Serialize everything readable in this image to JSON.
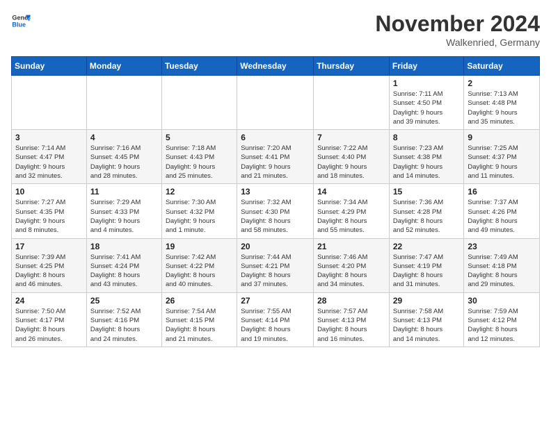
{
  "header": {
    "logo_general": "General",
    "logo_blue": "Blue",
    "month_title": "November 2024",
    "location": "Walkenried, Germany"
  },
  "calendar": {
    "days_of_week": [
      "Sunday",
      "Monday",
      "Tuesday",
      "Wednesday",
      "Thursday",
      "Friday",
      "Saturday"
    ],
    "weeks": [
      [
        {
          "day": "",
          "info": ""
        },
        {
          "day": "",
          "info": ""
        },
        {
          "day": "",
          "info": ""
        },
        {
          "day": "",
          "info": ""
        },
        {
          "day": "",
          "info": ""
        },
        {
          "day": "1",
          "info": "Sunrise: 7:11 AM\nSunset: 4:50 PM\nDaylight: 9 hours\nand 39 minutes."
        },
        {
          "day": "2",
          "info": "Sunrise: 7:13 AM\nSunset: 4:48 PM\nDaylight: 9 hours\nand 35 minutes."
        }
      ],
      [
        {
          "day": "3",
          "info": "Sunrise: 7:14 AM\nSunset: 4:47 PM\nDaylight: 9 hours\nand 32 minutes."
        },
        {
          "day": "4",
          "info": "Sunrise: 7:16 AM\nSunset: 4:45 PM\nDaylight: 9 hours\nand 28 minutes."
        },
        {
          "day": "5",
          "info": "Sunrise: 7:18 AM\nSunset: 4:43 PM\nDaylight: 9 hours\nand 25 minutes."
        },
        {
          "day": "6",
          "info": "Sunrise: 7:20 AM\nSunset: 4:41 PM\nDaylight: 9 hours\nand 21 minutes."
        },
        {
          "day": "7",
          "info": "Sunrise: 7:22 AM\nSunset: 4:40 PM\nDaylight: 9 hours\nand 18 minutes."
        },
        {
          "day": "8",
          "info": "Sunrise: 7:23 AM\nSunset: 4:38 PM\nDaylight: 9 hours\nand 14 minutes."
        },
        {
          "day": "9",
          "info": "Sunrise: 7:25 AM\nSunset: 4:37 PM\nDaylight: 9 hours\nand 11 minutes."
        }
      ],
      [
        {
          "day": "10",
          "info": "Sunrise: 7:27 AM\nSunset: 4:35 PM\nDaylight: 9 hours\nand 8 minutes."
        },
        {
          "day": "11",
          "info": "Sunrise: 7:29 AM\nSunset: 4:33 PM\nDaylight: 9 hours\nand 4 minutes."
        },
        {
          "day": "12",
          "info": "Sunrise: 7:30 AM\nSunset: 4:32 PM\nDaylight: 9 hours\nand 1 minute."
        },
        {
          "day": "13",
          "info": "Sunrise: 7:32 AM\nSunset: 4:30 PM\nDaylight: 8 hours\nand 58 minutes."
        },
        {
          "day": "14",
          "info": "Sunrise: 7:34 AM\nSunset: 4:29 PM\nDaylight: 8 hours\nand 55 minutes."
        },
        {
          "day": "15",
          "info": "Sunrise: 7:36 AM\nSunset: 4:28 PM\nDaylight: 8 hours\nand 52 minutes."
        },
        {
          "day": "16",
          "info": "Sunrise: 7:37 AM\nSunset: 4:26 PM\nDaylight: 8 hours\nand 49 minutes."
        }
      ],
      [
        {
          "day": "17",
          "info": "Sunrise: 7:39 AM\nSunset: 4:25 PM\nDaylight: 8 hours\nand 46 minutes."
        },
        {
          "day": "18",
          "info": "Sunrise: 7:41 AM\nSunset: 4:24 PM\nDaylight: 8 hours\nand 43 minutes."
        },
        {
          "day": "19",
          "info": "Sunrise: 7:42 AM\nSunset: 4:22 PM\nDaylight: 8 hours\nand 40 minutes."
        },
        {
          "day": "20",
          "info": "Sunrise: 7:44 AM\nSunset: 4:21 PM\nDaylight: 8 hours\nand 37 minutes."
        },
        {
          "day": "21",
          "info": "Sunrise: 7:46 AM\nSunset: 4:20 PM\nDaylight: 8 hours\nand 34 minutes."
        },
        {
          "day": "22",
          "info": "Sunrise: 7:47 AM\nSunset: 4:19 PM\nDaylight: 8 hours\nand 31 minutes."
        },
        {
          "day": "23",
          "info": "Sunrise: 7:49 AM\nSunset: 4:18 PM\nDaylight: 8 hours\nand 29 minutes."
        }
      ],
      [
        {
          "day": "24",
          "info": "Sunrise: 7:50 AM\nSunset: 4:17 PM\nDaylight: 8 hours\nand 26 minutes."
        },
        {
          "day": "25",
          "info": "Sunrise: 7:52 AM\nSunset: 4:16 PM\nDaylight: 8 hours\nand 24 minutes."
        },
        {
          "day": "26",
          "info": "Sunrise: 7:54 AM\nSunset: 4:15 PM\nDaylight: 8 hours\nand 21 minutes."
        },
        {
          "day": "27",
          "info": "Sunrise: 7:55 AM\nSunset: 4:14 PM\nDaylight: 8 hours\nand 19 minutes."
        },
        {
          "day": "28",
          "info": "Sunrise: 7:57 AM\nSunset: 4:13 PM\nDaylight: 8 hours\nand 16 minutes."
        },
        {
          "day": "29",
          "info": "Sunrise: 7:58 AM\nSunset: 4:13 PM\nDaylight: 8 hours\nand 14 minutes."
        },
        {
          "day": "30",
          "info": "Sunrise: 7:59 AM\nSunset: 4:12 PM\nDaylight: 8 hours\nand 12 minutes."
        }
      ]
    ]
  }
}
